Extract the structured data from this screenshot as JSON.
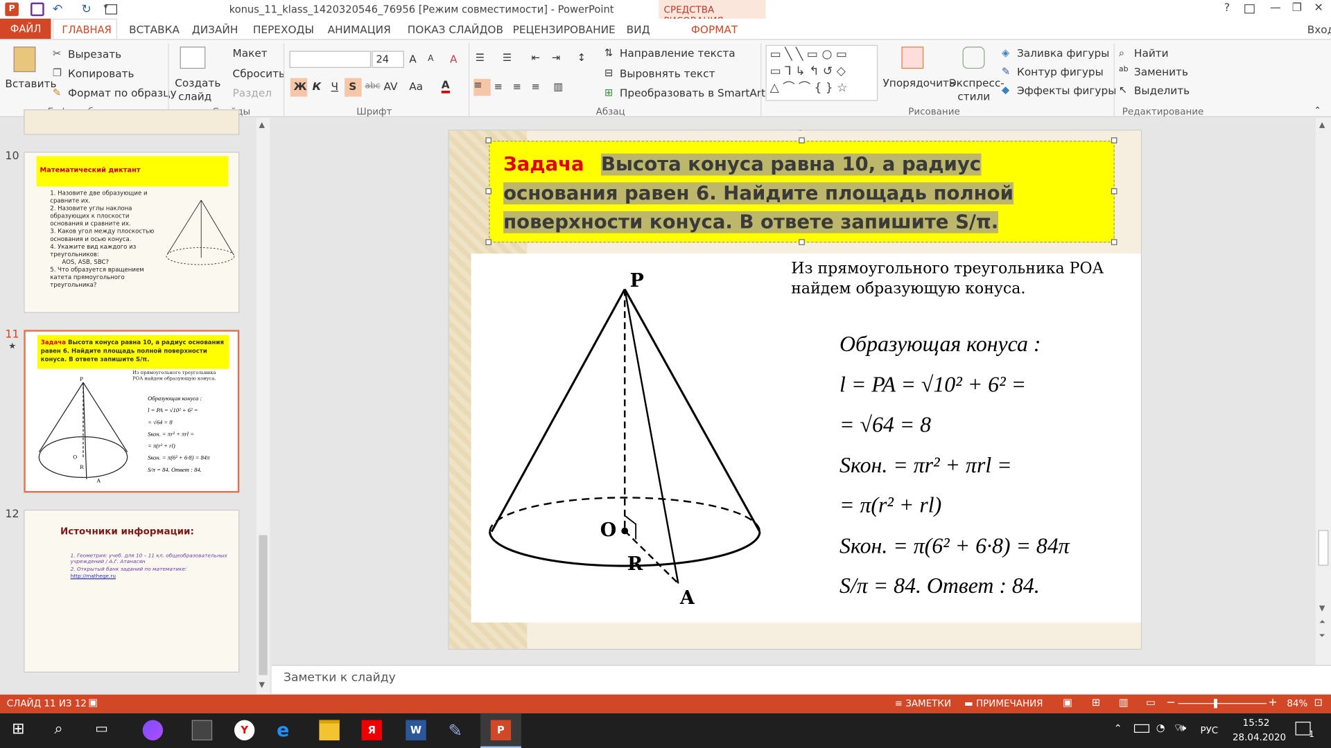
{
  "window": {
    "title": "konus_11_klass_1420320546_76956 [Режим совместимости] - PowerPoint",
    "context_group": "СРЕДСТВА РИСОВАНИЯ",
    "help": "?",
    "login": "Вход"
  },
  "tabs": [
    "ФАЙЛ",
    "ГЛАВНАЯ",
    "ВСТАВКА",
    "ДИЗАЙН",
    "ПЕРЕХОДЫ",
    "АНИМАЦИЯ",
    "ПОКАЗ СЛАЙДОВ",
    "РЕЦЕНЗИРОВАНИЕ",
    "ВИД",
    "ФОРМАТ"
  ],
  "ribbon": {
    "clipboard": {
      "paste": "Вставить",
      "cut": "Вырезать",
      "copy": "Копировать",
      "format_painter": "Формат по образцу",
      "label": "Буфер обмена"
    },
    "slides": {
      "new_slide_1": "Создать",
      "new_slide_2": "слайд",
      "layout": "Макет",
      "reset": "Сбросить",
      "section": "Раздел",
      "label": "Слайды"
    },
    "font": {
      "font_name": "",
      "font_size": "24",
      "bold": "Ж",
      "italic": "К",
      "underline": "Ч",
      "shadow": "S",
      "strike": "abc",
      "spacing": "AV",
      "case": "Aa",
      "color": "A",
      "label": "Шрифт"
    },
    "paragraph": {
      "text_direction": "Направление текста",
      "align_text": "Выровнять текст",
      "smartart": "Преобразовать в SmartArt",
      "label": "Абзац"
    },
    "drawing": {
      "arrange": "Упорядочить",
      "quick_styles_1": "Экспресс-",
      "quick_styles_2": "стили",
      "fill": "Заливка фигуры",
      "outline": "Контур фигуры",
      "effects": "Эффекты фигуры",
      "label": "Рисование"
    },
    "editing": {
      "find": "Найти",
      "replace": "Заменить",
      "select": "Выделить",
      "label": "Редактирование"
    }
  },
  "thumbnails": {
    "slide10": {
      "num": "10",
      "title": "Математический диктант",
      "items": [
        "1. Назовите две образующие и сравните их.",
        "2. Назовите углы наклона образующих к плоскости основания и сравните их.",
        "3. Каков угол между плоскостью основания и осью конуса.",
        "4. Укажите вид каждого из треугольников:",
        "AOS, ASB, SBC?",
        "5. Что образуется вращением катета прямоугольного треугольника?"
      ]
    },
    "slide11": {
      "num": "11",
      "star": "★",
      "task_word": "Задача",
      "task_text": "Высота конуса равна 10, а радиус основания равен 6. Найдите площадь полной поверхности конуса. В ответе запишите S/π.",
      "sub": "Из прямоугольного треугольника РОА найдем образующую конуса."
    },
    "slide12": {
      "num": "12",
      "title": "Источники информации:",
      "line1": "1. Геометрия: учеб. для 10 – 11 кл. общеобразовательных учреждений / А.Г. Атанасян",
      "line2": "2. Открытый банк заданий по математике:",
      "link": "http://mathege.ru"
    }
  },
  "slide": {
    "task_word": "Задача",
    "task_text": "Высота конуса равна 10, а радиус основания равен 6. Найдите площадь полной поверхности конуса. В ответе запишите S/π.",
    "intro_line1": "Из прямоугольного треугольника РОА",
    "intro_line2": "найдем образующую конуса.",
    "math": {
      "heading": "Образующая конуса :",
      "l1": "l = PA = √10² + 6² =",
      "l2": "= √64 = 8",
      "s1": "Sкон. = πr² + πrl =",
      "s2": "= π(r² + rl)",
      "s3": "Sкон. = π(6² + 6·8) = 84π",
      "s4": "S/π = 84.   Ответ : 84."
    },
    "labels": {
      "P": "P",
      "O": "O",
      "R": "R",
      "A": "A"
    }
  },
  "notes_placeholder": "Заметки к слайду",
  "status": {
    "slide_of": "СЛАЙД 11 ИЗ 12",
    "notes": "ЗАМЕТКИ",
    "comments": "ПРИМЕЧАНИЯ",
    "zoom": "84%"
  },
  "taskbar": {
    "lang": "РУС",
    "time": "15:52",
    "date": "28.04.2020",
    "notif_count": "1"
  },
  "colors": {
    "accent": "#d24726",
    "title_fill": "#ffff00",
    "title_red": "#e00000",
    "highlight": "#bdb76b"
  }
}
